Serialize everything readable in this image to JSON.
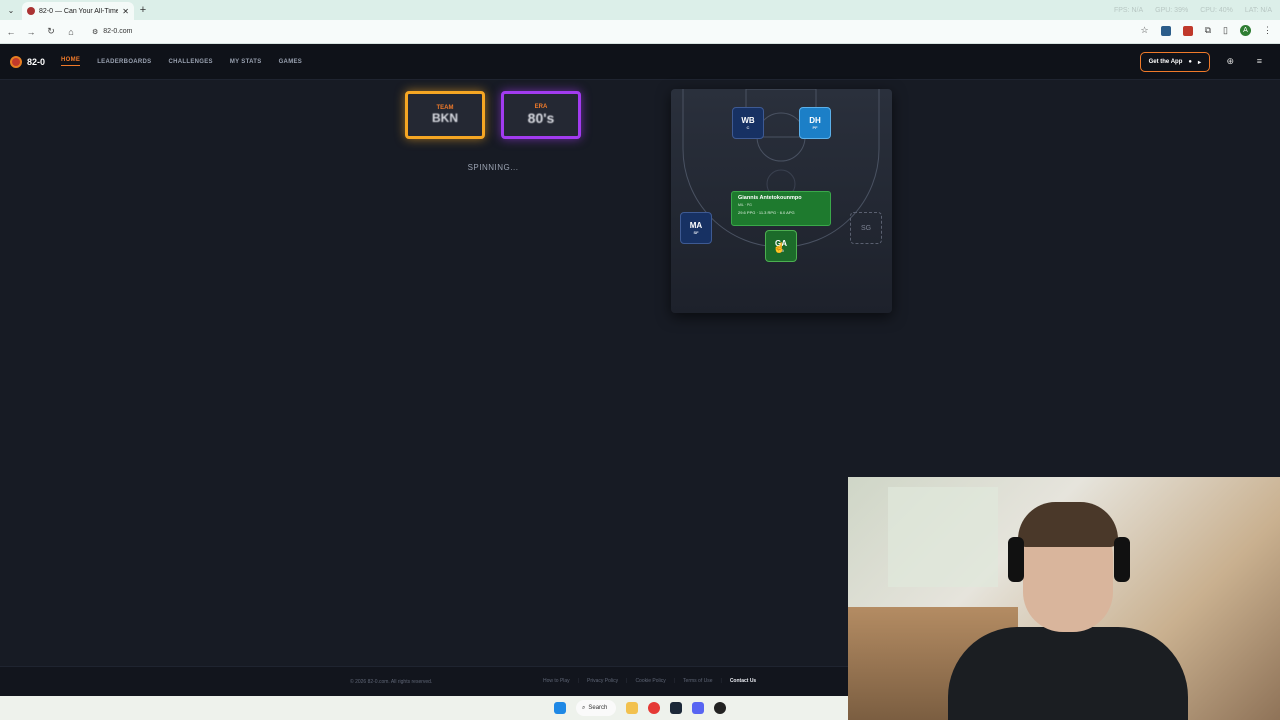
{
  "browser": {
    "tab_title": "82-0 — Can Your All-Time",
    "tab_close": "✕",
    "new_tab": "+",
    "url": "82-0.com",
    "sys_fps": "FPS: N/A",
    "sys_gpu": "GPU: 39%",
    "sys_cpu": "CPU: 40%",
    "sys_lat": "LAT: N/A"
  },
  "site": {
    "logo_text": "82-0",
    "nav": [
      "HOME",
      "LEADERBOARDS",
      "CHALLENGES",
      "MY STATS",
      "GAMES"
    ],
    "get_app": "Get the App",
    "get_app_icon": "▸"
  },
  "spin": {
    "team_label": "TEAM",
    "team_value": "BKN",
    "era_label": "ERA",
    "era_value": "80's",
    "status": "SPINNING..."
  },
  "court": {
    "positions": [
      {
        "initials": "WB",
        "pos": "C"
      },
      {
        "initials": "DH",
        "pos": "PF"
      },
      {
        "initials": "MA",
        "pos": "SF"
      },
      {
        "initials": "GA",
        "pos": "PG"
      },
      {
        "initials": "SG",
        "pos": ""
      }
    ],
    "player_card": {
      "name": "Giannis Antetokounmpo",
      "team": "MIL · PG",
      "stats": "29.6 PPG · 11.3 RPG · 6.0 APG"
    }
  },
  "footer": {
    "copyright": "© 2026 82-0.com. All rights reserved.",
    "links": [
      "How to Play",
      "Privacy Policy",
      "Cookie Policy",
      "Terms of Use",
      "Contact Us"
    ]
  },
  "taskbar": {
    "search": "Search"
  }
}
